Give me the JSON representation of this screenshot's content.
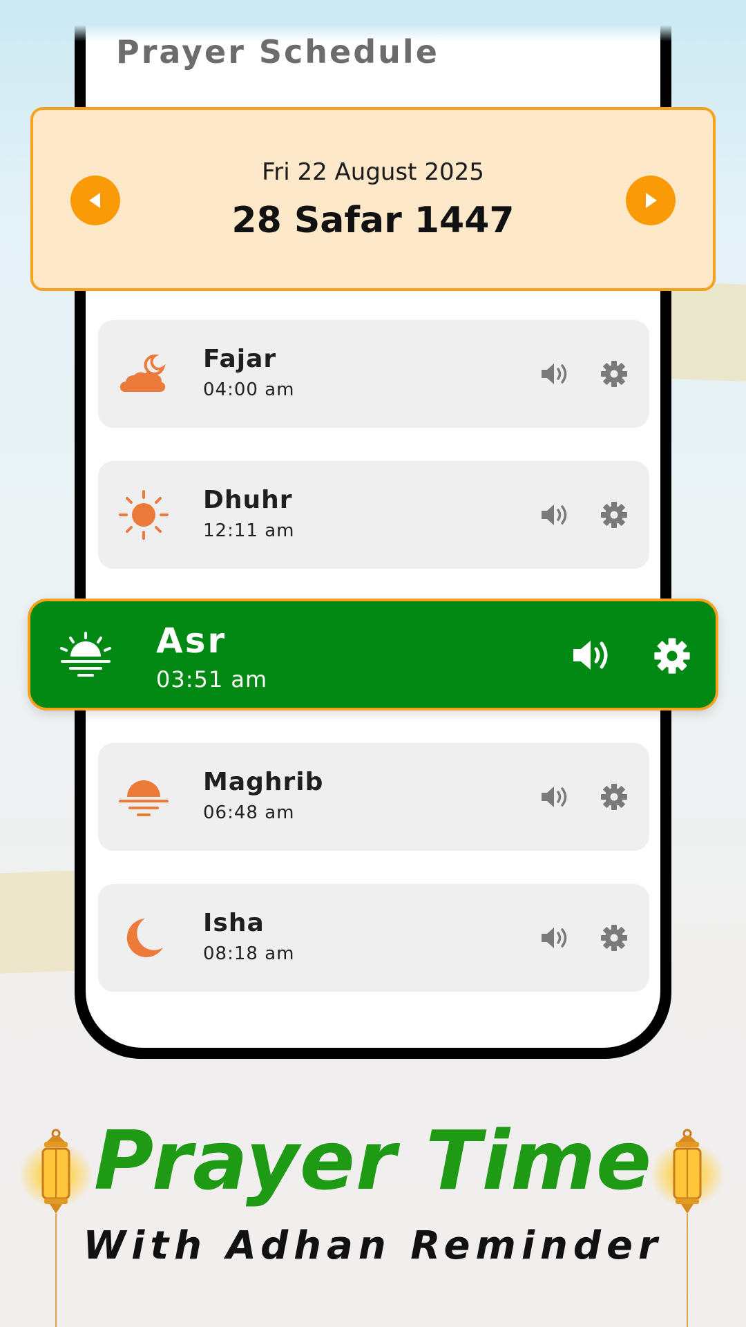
{
  "screen_title": "Prayer Schedule",
  "date_card": {
    "gregorian": "Fri 22 August 2025",
    "hijri": "28 Safar 1447"
  },
  "prayers": [
    {
      "name": "Fajar",
      "time": "04:00 am",
      "icon": "cloud-moon-icon"
    },
    {
      "name": "Dhuhr",
      "time": "12:11 am",
      "icon": "sun-icon"
    },
    {
      "name": "Asr",
      "time": "03:51 am",
      "icon": "sunrise-icon",
      "active": true
    },
    {
      "name": "Maghrib",
      "time": "06:48 am",
      "icon": "sunset-icon"
    },
    {
      "name": "Isha",
      "time": "08:18 am",
      "icon": "crescent-moon-icon"
    }
  ],
  "promo": {
    "title": "Prayer Time",
    "subtitle": "With Adhan Reminder"
  },
  "colors": {
    "accent_orange": "#f99a06",
    "active_green": "#018914",
    "icon_orange": "#ec7a3a",
    "title_green": "#1f9a14"
  }
}
